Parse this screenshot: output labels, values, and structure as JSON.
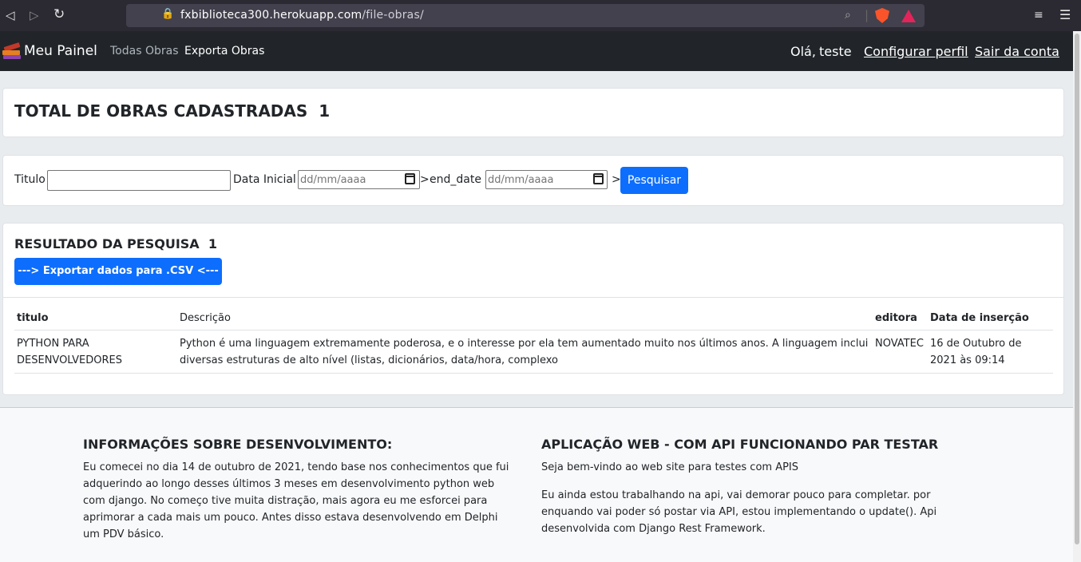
{
  "browser": {
    "url_host": "fxbiblioteca300.herokuapp.com",
    "url_path": "/file-obras/"
  },
  "navbar": {
    "brand": "Meu Painel",
    "links": [
      "Todas Obras",
      "Exporta Obras"
    ],
    "greeting": "Olá,",
    "username": "teste",
    "profile_link": "Configurar perfil",
    "logout_link": "Sair da conta"
  },
  "total": {
    "label": "TOTAL DE OBRAS CADASTRADAS",
    "count": "1"
  },
  "search": {
    "title_label": "Titulo",
    "title_value": "",
    "start_label": "Data Inicial :",
    "start_placeholder": "dd/mm/aaaa",
    "separator": ">",
    "end_label": "end_date :",
    "end_placeholder": "dd/mm/aaaa",
    "button": "Pesquisar"
  },
  "result": {
    "label": "RESULTADO DA PESQUISA",
    "count": "1",
    "export_button": "---> Exportar dados para .CSV <---",
    "columns": [
      "titulo",
      "Descrição",
      "editora",
      "Data de inserção"
    ],
    "rows": [
      {
        "titulo": "PYTHON PARA DESENVOLVEDORES",
        "descricao": "Python é uma linguagem extremamente poderosa, e o interesse por ela tem aumentado muito nos últimos anos. A linguagem inclui diversas estruturas de alto nível (listas, dicionários, data/hora, complexo",
        "editora": "NOVATEC",
        "data": "16 de Outubro de 2021 às 09:14"
      }
    ]
  },
  "footer": {
    "left_title": "INFORMAÇÕES SOBRE DESENVOLVIMENTO:",
    "left_text": "Eu comecei no dia 14 de outubro de 2021, tendo base nos conhecimentos que fui adquerindo ao longo desses últimos 3 meses em desenvolvimento python web com django. No começo tive muita distração, mais agora eu me esforcei para aprimorar a cada mais um pouco. Antes disso estava desenvolvendo em Delphi um PDV básico.",
    "right_title": "APLICAÇÃO WEB - COM API FUNCIONANDO PAR TESTAR",
    "right_text1": "Seja bem-vindo ao web site para testes com APIS",
    "right_text2": "Eu ainda estou trabalhando na api, vai demorar pouco para completar. por enquando vai poder só postar via API, estou implementando o update(). Api desenvolvida com Django Rest Framework."
  },
  "colors": {
    "primary": "#0d6efd",
    "navbar": "#212529",
    "page_bg": "#e9ecef"
  }
}
